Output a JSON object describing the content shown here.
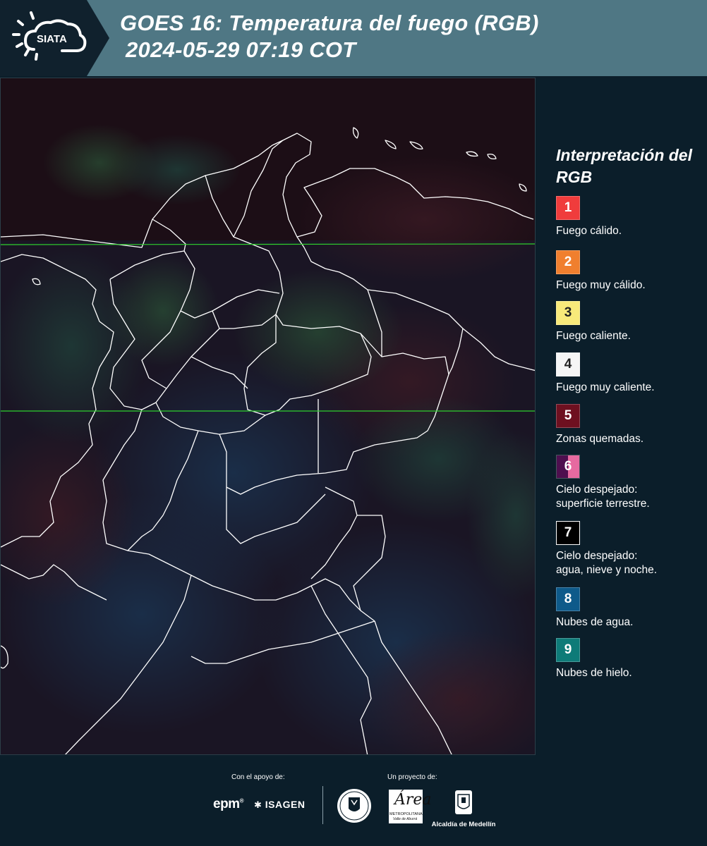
{
  "header": {
    "logo_text": "SIATA",
    "title_line1": "GOES 16: Temperatura del fuego (RGB)",
    "title_line2": "2024-05-29 07:19 COT"
  },
  "legend": {
    "title": "Interpretación del RGB",
    "items": [
      {
        "num": "1",
        "label": "Fuego cálido.",
        "color": "#f03c3c"
      },
      {
        "num": "2",
        "label": "Fuego muy cálido.",
        "color": "#f07f2e"
      },
      {
        "num": "3",
        "label": "Fuego caliente.",
        "color": "#f8e97a"
      },
      {
        "num": "4",
        "label": "Fuego muy caliente.",
        "color": "#f5f5f5"
      },
      {
        "num": "5",
        "label": "Zonas quemadas.",
        "color": "#6e1020"
      },
      {
        "num": "6",
        "label": "Cielo despejado:\nsuperficie terrestre.",
        "color": "#4e0f4f",
        "color2": "#e66aa0"
      },
      {
        "num": "7",
        "label": "Cielo despejado:\nagua, nieve y noche.",
        "color": "#000000"
      },
      {
        "num": "8",
        "label": "Nubes de agua.",
        "color": "#0e5a8a"
      },
      {
        "num": "9",
        "label": "Nubes de hielo.",
        "color": "#0e7b78"
      }
    ]
  },
  "footer": {
    "support_label": "Con el apoyo de:",
    "project_label": "Un proyecto de:",
    "sponsor1": "epm",
    "sponsor2": "ISAGEN",
    "area_logo_letter": "Área",
    "area_logo_line1": "METROPOLITANA",
    "area_logo_line2": "Valle de Aburrá",
    "partner_label": "Alcaldía de Medellín"
  },
  "colors": {
    "header_bg": "#4f7784",
    "page_bg": "#0b1e2a",
    "gridline": "#2ed12e"
  }
}
